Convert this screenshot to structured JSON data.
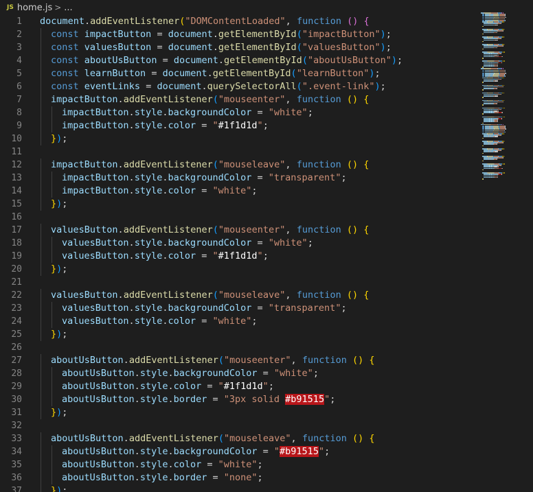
{
  "breadcrumb": {
    "file_icon": "JS",
    "file_name": "home.js",
    "separator": ">",
    "ellipsis": "..."
  },
  "colors": {
    "variable": "#9cdcfe",
    "function": "#dcdcaa",
    "keyword": "#569cd6",
    "string": "#ce9178",
    "punctuation": "#d4d4d4",
    "bracket_1": "#ffd700",
    "bracket_2": "#da70d6",
    "bracket_3": "#179fff",
    "color_swatch_bg": "#b8161a"
  },
  "code_lines": [
    {
      "n": "1",
      "indent": 0,
      "tokens": [
        [
          "document",
          "var"
        ],
        [
          ".",
          "p"
        ],
        [
          "addEventListener",
          "fn"
        ],
        [
          "(",
          "br1"
        ],
        [
          "\"DOMContentLoaded\"",
          "str"
        ],
        [
          ", ",
          "p"
        ],
        [
          "function",
          "kw"
        ],
        [
          " ",
          "p"
        ],
        [
          "()",
          "br2"
        ],
        [
          " ",
          "p"
        ],
        [
          "{",
          "br2"
        ]
      ]
    },
    {
      "n": "2",
      "indent": 1,
      "tokens": [
        [
          "const",
          "kw"
        ],
        [
          " ",
          "p"
        ],
        [
          "impactButton",
          "var"
        ],
        [
          " = ",
          "p"
        ],
        [
          "document",
          "var"
        ],
        [
          ".",
          "p"
        ],
        [
          "getElementById",
          "fn"
        ],
        [
          "(",
          "br3"
        ],
        [
          "\"impactButton\"",
          "str"
        ],
        [
          ")",
          "br3"
        ],
        [
          ";",
          "p"
        ]
      ]
    },
    {
      "n": "3",
      "indent": 1,
      "tokens": [
        [
          "const",
          "kw"
        ],
        [
          " ",
          "p"
        ],
        [
          "valuesButton",
          "var"
        ],
        [
          " = ",
          "p"
        ],
        [
          "document",
          "var"
        ],
        [
          ".",
          "p"
        ],
        [
          "getElementById",
          "fn"
        ],
        [
          "(",
          "br3"
        ],
        [
          "\"valuesButton\"",
          "str"
        ],
        [
          ")",
          "br3"
        ],
        [
          ";",
          "p"
        ]
      ]
    },
    {
      "n": "4",
      "indent": 1,
      "tokens": [
        [
          "const",
          "kw"
        ],
        [
          " ",
          "p"
        ],
        [
          "aboutUsButton",
          "var"
        ],
        [
          " = ",
          "p"
        ],
        [
          "document",
          "var"
        ],
        [
          ".",
          "p"
        ],
        [
          "getElementById",
          "fn"
        ],
        [
          "(",
          "br3"
        ],
        [
          "\"aboutUsButton\"",
          "str"
        ],
        [
          ")",
          "br3"
        ],
        [
          ";",
          "p"
        ]
      ]
    },
    {
      "n": "5",
      "indent": 1,
      "tokens": [
        [
          "const",
          "kw"
        ],
        [
          " ",
          "p"
        ],
        [
          "learnButton",
          "var"
        ],
        [
          " = ",
          "p"
        ],
        [
          "document",
          "var"
        ],
        [
          ".",
          "p"
        ],
        [
          "getElementById",
          "fn"
        ],
        [
          "(",
          "br3"
        ],
        [
          "\"learnButton\"",
          "str"
        ],
        [
          ")",
          "br3"
        ],
        [
          ";",
          "p"
        ]
      ]
    },
    {
      "n": "6",
      "indent": 1,
      "tokens": [
        [
          "const",
          "kw"
        ],
        [
          " ",
          "p"
        ],
        [
          "eventLinks",
          "var"
        ],
        [
          " = ",
          "p"
        ],
        [
          "document",
          "var"
        ],
        [
          ".",
          "p"
        ],
        [
          "querySelectorAll",
          "fn"
        ],
        [
          "(",
          "br3"
        ],
        [
          "\".event-link\"",
          "str"
        ],
        [
          ")",
          "br3"
        ],
        [
          ";",
          "p"
        ]
      ]
    },
    {
      "n": "7",
      "indent": 1,
      "tokens": [
        [
          "impactButton",
          "var"
        ],
        [
          ".",
          "p"
        ],
        [
          "addEventListener",
          "fn"
        ],
        [
          "(",
          "br3"
        ],
        [
          "\"mouseenter\"",
          "str"
        ],
        [
          ", ",
          "p"
        ],
        [
          "function",
          "kw"
        ],
        [
          " ",
          "p"
        ],
        [
          "()",
          "br1"
        ],
        [
          " ",
          "p"
        ],
        [
          "{",
          "br1"
        ]
      ]
    },
    {
      "n": "8",
      "indent": 2,
      "tokens": [
        [
          "impactButton",
          "var"
        ],
        [
          ".",
          "p"
        ],
        [
          "style",
          "var"
        ],
        [
          ".",
          "p"
        ],
        [
          "backgroundColor",
          "var"
        ],
        [
          " = ",
          "p"
        ],
        [
          "\"white\"",
          "str"
        ],
        [
          ";",
          "p"
        ]
      ]
    },
    {
      "n": "9",
      "indent": 2,
      "tokens": [
        [
          "impactButton",
          "var"
        ],
        [
          ".",
          "p"
        ],
        [
          "style",
          "var"
        ],
        [
          ".",
          "p"
        ],
        [
          "color",
          "var"
        ],
        [
          " = ",
          "p"
        ],
        [
          "\"",
          "str"
        ],
        [
          "#1f1d1d",
          "white"
        ],
        [
          "\"",
          "str"
        ],
        [
          ";",
          "p"
        ]
      ]
    },
    {
      "n": "10",
      "indent": 1,
      "tokens": [
        [
          "}",
          "br1"
        ],
        [
          ")",
          "br3"
        ],
        [
          ";",
          "p"
        ]
      ]
    },
    {
      "n": "11",
      "indent": 0,
      "tokens": []
    },
    {
      "n": "12",
      "indent": 1,
      "tokens": [
        [
          "impactButton",
          "var"
        ],
        [
          ".",
          "p"
        ],
        [
          "addEventListener",
          "fn"
        ],
        [
          "(",
          "br3"
        ],
        [
          "\"mouseleave\"",
          "str"
        ],
        [
          ", ",
          "p"
        ],
        [
          "function",
          "kw"
        ],
        [
          " ",
          "p"
        ],
        [
          "()",
          "br1"
        ],
        [
          " ",
          "p"
        ],
        [
          "{",
          "br1"
        ]
      ]
    },
    {
      "n": "13",
      "indent": 2,
      "tokens": [
        [
          "impactButton",
          "var"
        ],
        [
          ".",
          "p"
        ],
        [
          "style",
          "var"
        ],
        [
          ".",
          "p"
        ],
        [
          "backgroundColor",
          "var"
        ],
        [
          " = ",
          "p"
        ],
        [
          "\"transparent\"",
          "str"
        ],
        [
          ";",
          "p"
        ]
      ]
    },
    {
      "n": "14",
      "indent": 2,
      "tokens": [
        [
          "impactButton",
          "var"
        ],
        [
          ".",
          "p"
        ],
        [
          "style",
          "var"
        ],
        [
          ".",
          "p"
        ],
        [
          "color",
          "var"
        ],
        [
          " = ",
          "p"
        ],
        [
          "\"white\"",
          "str"
        ],
        [
          ";",
          "p"
        ]
      ]
    },
    {
      "n": "15",
      "indent": 1,
      "tokens": [
        [
          "}",
          "br1"
        ],
        [
          ")",
          "br3"
        ],
        [
          ";",
          "p"
        ]
      ]
    },
    {
      "n": "16",
      "indent": 0,
      "tokens": []
    },
    {
      "n": "17",
      "indent": 1,
      "tokens": [
        [
          "valuesButton",
          "var"
        ],
        [
          ".",
          "p"
        ],
        [
          "addEventListener",
          "fn"
        ],
        [
          "(",
          "br3"
        ],
        [
          "\"mouseenter\"",
          "str"
        ],
        [
          ", ",
          "p"
        ],
        [
          "function",
          "kw"
        ],
        [
          " ",
          "p"
        ],
        [
          "()",
          "br1"
        ],
        [
          " ",
          "p"
        ],
        [
          "{",
          "br1"
        ]
      ]
    },
    {
      "n": "18",
      "indent": 2,
      "tokens": [
        [
          "valuesButton",
          "var"
        ],
        [
          ".",
          "p"
        ],
        [
          "style",
          "var"
        ],
        [
          ".",
          "p"
        ],
        [
          "backgroundColor",
          "var"
        ],
        [
          " = ",
          "p"
        ],
        [
          "\"white\"",
          "str"
        ],
        [
          ";",
          "p"
        ]
      ]
    },
    {
      "n": "19",
      "indent": 2,
      "tokens": [
        [
          "valuesButton",
          "var"
        ],
        [
          ".",
          "p"
        ],
        [
          "style",
          "var"
        ],
        [
          ".",
          "p"
        ],
        [
          "color",
          "var"
        ],
        [
          " = ",
          "p"
        ],
        [
          "\"",
          "str"
        ],
        [
          "#1f1d1d",
          "white"
        ],
        [
          "\"",
          "str"
        ],
        [
          ";",
          "p"
        ]
      ]
    },
    {
      "n": "20",
      "indent": 1,
      "tokens": [
        [
          "}",
          "br1"
        ],
        [
          ")",
          "br3"
        ],
        [
          ";",
          "p"
        ]
      ]
    },
    {
      "n": "21",
      "indent": 0,
      "tokens": []
    },
    {
      "n": "22",
      "indent": 1,
      "tokens": [
        [
          "valuesButton",
          "var"
        ],
        [
          ".",
          "p"
        ],
        [
          "addEventListener",
          "fn"
        ],
        [
          "(",
          "br3"
        ],
        [
          "\"mouseleave\"",
          "str"
        ],
        [
          ", ",
          "p"
        ],
        [
          "function",
          "kw"
        ],
        [
          " ",
          "p"
        ],
        [
          "()",
          "br1"
        ],
        [
          " ",
          "p"
        ],
        [
          "{",
          "br1"
        ]
      ]
    },
    {
      "n": "23",
      "indent": 2,
      "tokens": [
        [
          "valuesButton",
          "var"
        ],
        [
          ".",
          "p"
        ],
        [
          "style",
          "var"
        ],
        [
          ".",
          "p"
        ],
        [
          "backgroundColor",
          "var"
        ],
        [
          " = ",
          "p"
        ],
        [
          "\"transparent\"",
          "str"
        ],
        [
          ";",
          "p"
        ]
      ]
    },
    {
      "n": "24",
      "indent": 2,
      "tokens": [
        [
          "valuesButton",
          "var"
        ],
        [
          ".",
          "p"
        ],
        [
          "style",
          "var"
        ],
        [
          ".",
          "p"
        ],
        [
          "color",
          "var"
        ],
        [
          " = ",
          "p"
        ],
        [
          "\"white\"",
          "str"
        ],
        [
          ";",
          "p"
        ]
      ]
    },
    {
      "n": "25",
      "indent": 1,
      "tokens": [
        [
          "}",
          "br1"
        ],
        [
          ")",
          "br3"
        ],
        [
          ";",
          "p"
        ]
      ]
    },
    {
      "n": "26",
      "indent": 0,
      "tokens": []
    },
    {
      "n": "27",
      "indent": 1,
      "tokens": [
        [
          "aboutUsButton",
          "var"
        ],
        [
          ".",
          "p"
        ],
        [
          "addEventListener",
          "fn"
        ],
        [
          "(",
          "br3"
        ],
        [
          "\"mouseenter\"",
          "str"
        ],
        [
          ", ",
          "p"
        ],
        [
          "function",
          "kw"
        ],
        [
          " ",
          "p"
        ],
        [
          "()",
          "br1"
        ],
        [
          " ",
          "p"
        ],
        [
          "{",
          "br1"
        ]
      ]
    },
    {
      "n": "28",
      "indent": 2,
      "tokens": [
        [
          "aboutUsButton",
          "var"
        ],
        [
          ".",
          "p"
        ],
        [
          "style",
          "var"
        ],
        [
          ".",
          "p"
        ],
        [
          "backgroundColor",
          "var"
        ],
        [
          " = ",
          "p"
        ],
        [
          "\"white\"",
          "str"
        ],
        [
          ";",
          "p"
        ]
      ]
    },
    {
      "n": "29",
      "indent": 2,
      "tokens": [
        [
          "aboutUsButton",
          "var"
        ],
        [
          ".",
          "p"
        ],
        [
          "style",
          "var"
        ],
        [
          ".",
          "p"
        ],
        [
          "color",
          "var"
        ],
        [
          " = ",
          "p"
        ],
        [
          "\"",
          "str"
        ],
        [
          "#1f1d1d",
          "white"
        ],
        [
          "\"",
          "str"
        ],
        [
          ";",
          "p"
        ]
      ]
    },
    {
      "n": "30",
      "indent": 2,
      "tokens": [
        [
          "aboutUsButton",
          "var"
        ],
        [
          ".",
          "p"
        ],
        [
          "style",
          "var"
        ],
        [
          ".",
          "p"
        ],
        [
          "border",
          "var"
        ],
        [
          " = ",
          "p"
        ],
        [
          "\"3px solid ",
          "str"
        ],
        [
          "#b91515",
          "color"
        ],
        [
          "\"",
          "str"
        ],
        [
          ";",
          "p"
        ]
      ]
    },
    {
      "n": "31",
      "indent": 1,
      "tokens": [
        [
          "}",
          "br1"
        ],
        [
          ")",
          "br3"
        ],
        [
          ";",
          "p"
        ]
      ]
    },
    {
      "n": "32",
      "indent": 0,
      "tokens": []
    },
    {
      "n": "33",
      "indent": 1,
      "tokens": [
        [
          "aboutUsButton",
          "var"
        ],
        [
          ".",
          "p"
        ],
        [
          "addEventListener",
          "fn"
        ],
        [
          "(",
          "br3"
        ],
        [
          "\"mouseleave\"",
          "str"
        ],
        [
          ", ",
          "p"
        ],
        [
          "function",
          "kw"
        ],
        [
          " ",
          "p"
        ],
        [
          "()",
          "br1"
        ],
        [
          " ",
          "p"
        ],
        [
          "{",
          "br1"
        ]
      ]
    },
    {
      "n": "34",
      "indent": 2,
      "tokens": [
        [
          "aboutUsButton",
          "var"
        ],
        [
          ".",
          "p"
        ],
        [
          "style",
          "var"
        ],
        [
          ".",
          "p"
        ],
        [
          "backgroundColor",
          "var"
        ],
        [
          " = ",
          "p"
        ],
        [
          "\"",
          "str"
        ],
        [
          "#b91515",
          "color"
        ],
        [
          "\"",
          "str"
        ],
        [
          ";",
          "p"
        ]
      ]
    },
    {
      "n": "35",
      "indent": 2,
      "tokens": [
        [
          "aboutUsButton",
          "var"
        ],
        [
          ".",
          "p"
        ],
        [
          "style",
          "var"
        ],
        [
          ".",
          "p"
        ],
        [
          "color",
          "var"
        ],
        [
          " = ",
          "p"
        ],
        [
          "\"white\"",
          "str"
        ],
        [
          ";",
          "p"
        ]
      ]
    },
    {
      "n": "36",
      "indent": 2,
      "tokens": [
        [
          "aboutUsButton",
          "var"
        ],
        [
          ".",
          "p"
        ],
        [
          "style",
          "var"
        ],
        [
          ".",
          "p"
        ],
        [
          "border",
          "var"
        ],
        [
          " = ",
          "p"
        ],
        [
          "\"none\"",
          "str"
        ],
        [
          ";",
          "p"
        ]
      ]
    },
    {
      "n": "37",
      "indent": 1,
      "tokens": [
        [
          "}",
          "br1"
        ],
        [
          ")",
          "br3"
        ],
        [
          ";",
          "p"
        ]
      ]
    }
  ]
}
